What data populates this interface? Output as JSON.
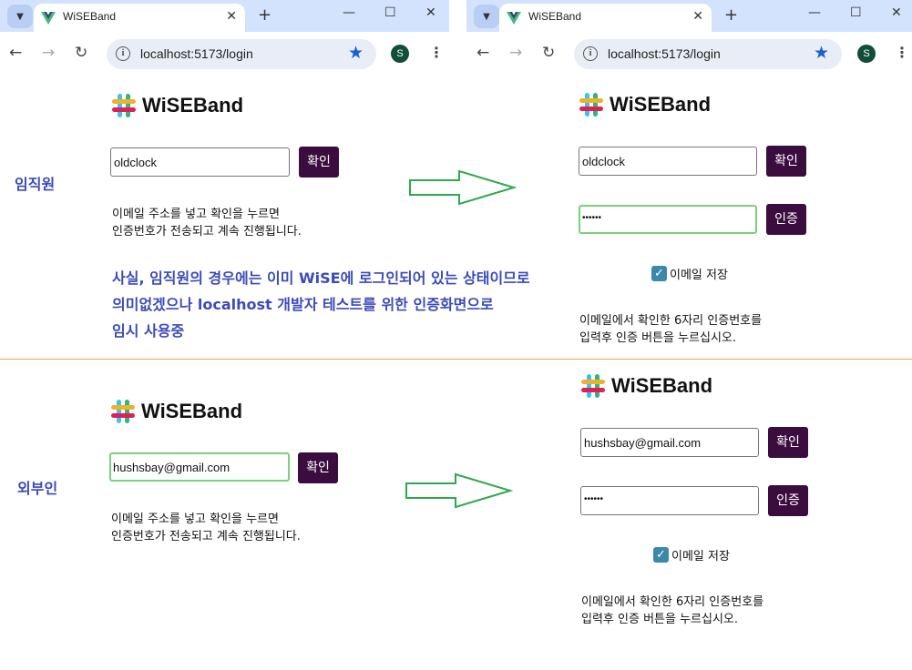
{
  "browser": {
    "tab_title": "WiSEBand",
    "url": "localhost:5173/login",
    "profile_initial": "S"
  },
  "brand": {
    "name": "WiSEBand"
  },
  "sections": {
    "employee": {
      "role_label": "임직원",
      "left": {
        "email_value": "oldclock",
        "confirm_label": "확인",
        "desc_line1": "이메일 주소를 넣고 확인을 누르면",
        "desc_line2": "인증번호가 전송되고 계속 진행됩니다."
      },
      "note_lines": [
        "사실, 임직원의 경우에는 이미 WiSE에 로그인되어 있는 상태이므로",
        "의미없겠으나 localhost 개발자 테스트를 위한 인증화면으로",
        "임시 사용중"
      ],
      "right": {
        "email_value": "oldclock",
        "confirm_label": "확인",
        "code_value": "••••••",
        "verify_label": "인증",
        "remember_label": "이메일 저장",
        "remember_checked": true,
        "desc_line1": "이메일에서 확인한 6자리 인증번호를",
        "desc_line2": "입력후 인증 버튼을 누르십시오."
      }
    },
    "external": {
      "role_label": "외부인",
      "left": {
        "email_value": "hushsbay@gmail.com",
        "confirm_label": "확인",
        "desc_line1": "이메일 주소를 넣고 확인을 누르면",
        "desc_line2": "인증번호가 전송되고 계속 진행됩니다."
      },
      "right": {
        "email_value": "hushsbay@gmail.com",
        "confirm_label": "확인",
        "code_value": "••••••",
        "verify_label": "인증",
        "remember_label": "이메일 저장",
        "remember_checked": true,
        "desc_line1": "이메일에서 확인한 6자리 인증번호를",
        "desc_line2": "입력후 인증 버튼을 누르십시오."
      }
    }
  },
  "colors": {
    "button_bg": "#3b0d3f",
    "annotation_text": "#3b4bb8",
    "arrow_stroke": "#2fa84f",
    "divider": "#f0a060",
    "tabstrip_bg": "#d3e3fd"
  }
}
